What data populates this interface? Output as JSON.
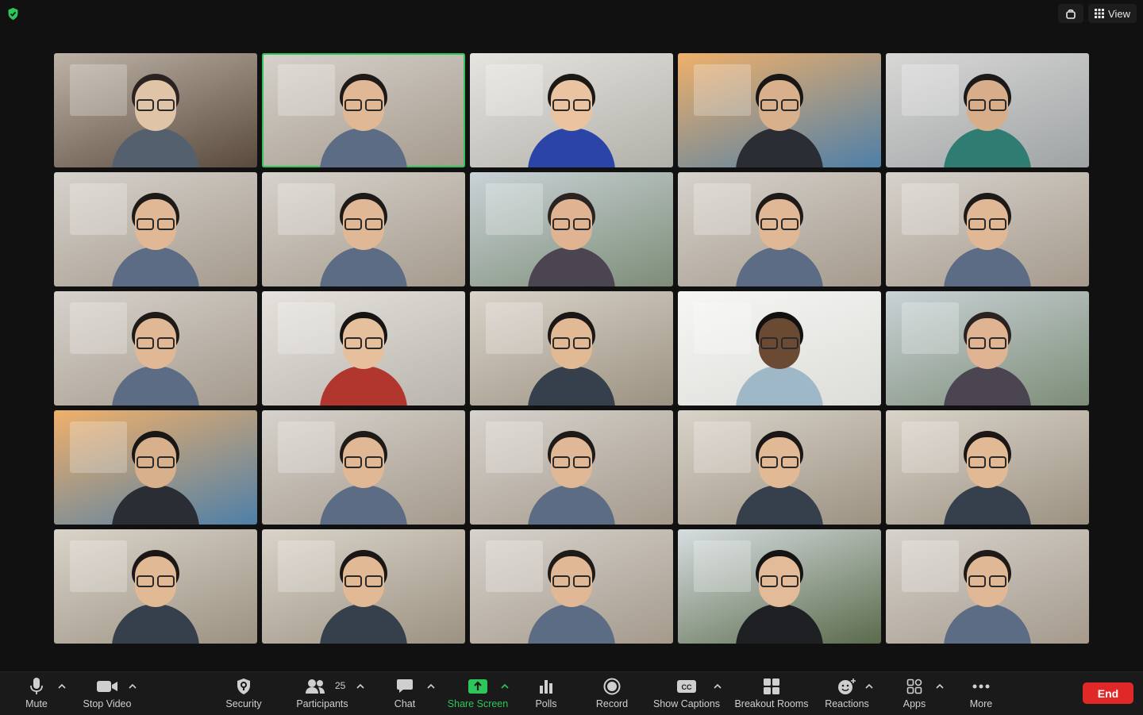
{
  "colors": {
    "background": "#111111",
    "toolbar": "#1a1a1a",
    "accent_green": "#2dc65a",
    "end_red": "#e02828"
  },
  "top": {
    "view_label": "View"
  },
  "tiles": [
    {
      "id": "t1",
      "scene": "office-room"
    },
    {
      "id": "t2",
      "scene": "home",
      "active": true
    },
    {
      "id": "t3",
      "scene": "whiteboard"
    },
    {
      "id": "t4",
      "scene": "golden-gate"
    },
    {
      "id": "t5",
      "scene": "office"
    },
    {
      "id": "t6",
      "scene": "home"
    },
    {
      "id": "t7",
      "scene": "home"
    },
    {
      "id": "t8",
      "scene": "atrium"
    },
    {
      "id": "t9",
      "scene": "home"
    },
    {
      "id": "t10",
      "scene": "home"
    },
    {
      "id": "t11",
      "scene": "home"
    },
    {
      "id": "t12",
      "scene": "curtain"
    },
    {
      "id": "t13",
      "scene": "blurred"
    },
    {
      "id": "t14",
      "scene": "bright"
    },
    {
      "id": "t15",
      "scene": "atrium"
    },
    {
      "id": "t16",
      "scene": "golden-gate"
    },
    {
      "id": "t17",
      "scene": "home"
    },
    {
      "id": "t18",
      "scene": "home"
    },
    {
      "id": "t19",
      "scene": "blurred"
    },
    {
      "id": "t20",
      "scene": "blurred"
    },
    {
      "id": "t21",
      "scene": "blurred"
    },
    {
      "id": "t22",
      "scene": "blurred"
    },
    {
      "id": "t23",
      "scene": "home"
    },
    {
      "id": "t24",
      "scene": "plant-window"
    },
    {
      "id": "t25",
      "scene": "home"
    }
  ],
  "toolbar": {
    "mute": "Mute",
    "stop_video": "Stop Video",
    "security": "Security",
    "participants": "Participants",
    "participants_count": "25",
    "chat": "Chat",
    "share_screen": "Share Screen",
    "polls": "Polls",
    "record": "Record",
    "show_captions": "Show Captions",
    "breakout_rooms": "Breakout Rooms",
    "reactions": "Reactions",
    "apps": "Apps",
    "more": "More",
    "end": "End"
  },
  "icons": [
    "shield-check-icon",
    "cast-icon",
    "grid-view-icon",
    "microphone-icon",
    "video-camera-icon",
    "security-shield-icon",
    "participants-icon",
    "chat-bubble-icon",
    "share-screen-icon",
    "polls-icon",
    "record-icon",
    "captions-icon",
    "breakout-rooms-icon",
    "reactions-icon",
    "apps-icon",
    "more-icon"
  ]
}
